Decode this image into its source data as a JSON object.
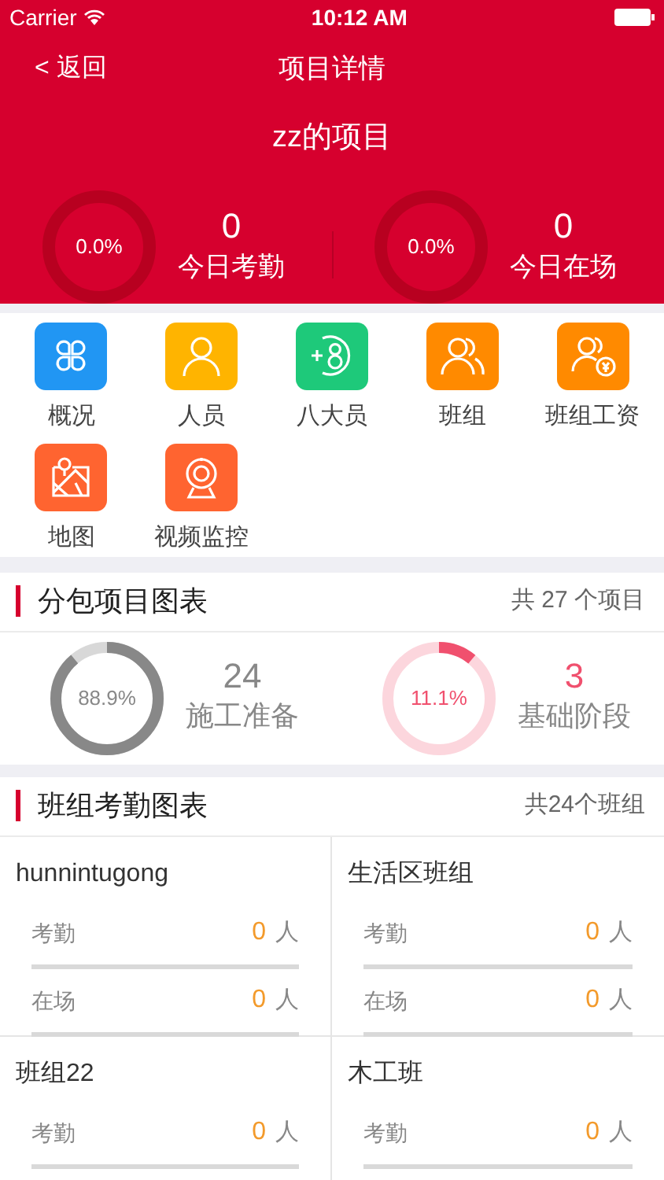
{
  "status_bar": {
    "carrier": "Carrier",
    "time": "10:12 AM"
  },
  "nav": {
    "back": "< 返回",
    "title": "项目详情"
  },
  "project": {
    "name": "zz的项目",
    "stats": [
      {
        "percent": "0.0%",
        "level": 0,
        "count": "0",
        "label": "今日考勤"
      },
      {
        "percent": "0.0%",
        "level": 0,
        "count": "0",
        "label": "今日在场"
      }
    ]
  },
  "menu": [
    {
      "label": "概况",
      "kind": "overview",
      "color": "#2196f3"
    },
    {
      "label": "人员",
      "kind": "person",
      "color": "#ffb400"
    },
    {
      "label": "八大员",
      "kind": "eight",
      "color": "#1ec97a"
    },
    {
      "label": "班组",
      "kind": "team",
      "color": "#ff8a00"
    },
    {
      "label": "班组工资",
      "kind": "wage",
      "color": "#ff8a00"
    },
    {
      "label": "地图",
      "kind": "map",
      "color": "#ff6430"
    },
    {
      "label": "视频监控",
      "kind": "camera",
      "color": "#ff6430"
    }
  ],
  "subcontract": {
    "title": "分包项目图表",
    "total": "共 27 个项目",
    "items": [
      {
        "percent": "88.9%",
        "level": 0.889,
        "count": "24",
        "label": "施工准备",
        "color": "#888888"
      },
      {
        "percent": "11.1%",
        "level": 0.111,
        "count": "3",
        "label": "基础阶段",
        "color": "#f0506e"
      }
    ]
  },
  "attendance": {
    "title": "班组考勤图表",
    "total": "共24个班组",
    "teams": [
      {
        "name": "hunnintugong",
        "rows": [
          {
            "label": "考勤",
            "count": "0",
            "unit": "人"
          },
          {
            "label": "在场",
            "count": "0",
            "unit": "人"
          }
        ]
      },
      {
        "name": "生活区班组",
        "rows": [
          {
            "label": "考勤",
            "count": "0",
            "unit": "人"
          },
          {
            "label": "在场",
            "count": "0",
            "unit": "人"
          }
        ]
      },
      {
        "name": "班组22",
        "rows": [
          {
            "label": "考勤",
            "count": "0",
            "unit": "人"
          }
        ]
      },
      {
        "name": "木工班",
        "rows": [
          {
            "label": "考勤",
            "count": "0",
            "unit": "人"
          }
        ]
      }
    ]
  }
}
